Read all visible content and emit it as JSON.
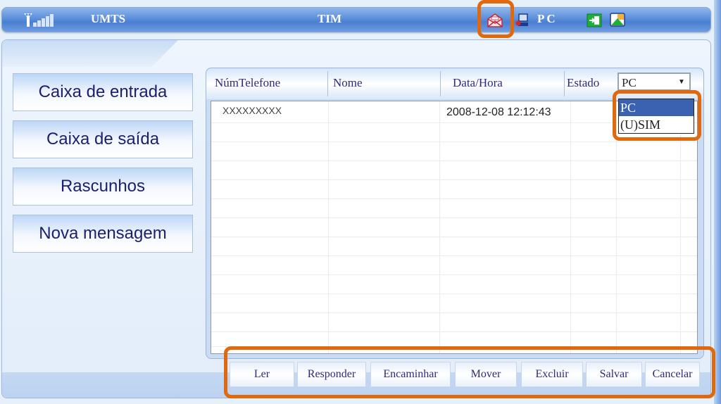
{
  "status_bar": {
    "network_type": "UMTS",
    "operator": "TIM",
    "storage_label": "PC",
    "icons": [
      "signal-strength-icon",
      "sms-envelope-icon",
      "pc-connection-icon",
      "connect-icon",
      "picture-icon"
    ]
  },
  "sidebar": {
    "items": [
      {
        "label": "Caixa de entrada"
      },
      {
        "label": "Caixa de saída"
      },
      {
        "label": "Rascunhos"
      },
      {
        "label": "Nova mensagem"
      }
    ]
  },
  "table": {
    "columns": [
      "NúmTelefone",
      "Nome",
      "Data/Hora",
      "Estado"
    ],
    "rows": [
      {
        "phone": "XXXXXXXXX",
        "name": "",
        "datetime": "2008-12-08  12:12:43",
        "status": ""
      }
    ]
  },
  "storage_select": {
    "selected": "PC",
    "options": [
      "PC",
      "(U)SIM"
    ]
  },
  "actions": {
    "buttons": [
      "Ler",
      "Responder",
      "Encaminhar",
      "Mover",
      "Excluir",
      "Salvar",
      "Cancelar"
    ]
  },
  "colors": {
    "highlight": "#e0690e",
    "selected_option": "#3b62b0",
    "text_primary": "#1b1f6e"
  }
}
